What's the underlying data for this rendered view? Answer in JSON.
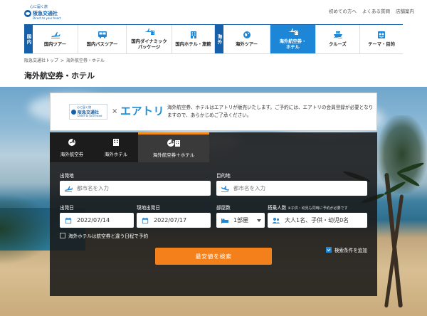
{
  "logo": {
    "tagline": "心に届く旅",
    "name": "阪急交通社",
    "english": "Direct to your heart"
  },
  "utility_links": [
    "初めての方へ",
    "よくある質問",
    "店舗案内"
  ],
  "nav": {
    "domestic_label": "国内",
    "overseas_label": "海外",
    "domestic_items": [
      {
        "label": "国内ツアー",
        "icon": "plane-domestic-icon"
      },
      {
        "label": "国内バスツアー",
        "icon": "bus-icon"
      },
      {
        "label": "国内ダイナミック\nパッケージ",
        "icon": "dynamic-package-icon"
      },
      {
        "label": "国内ホテル・旅館",
        "icon": "hotel-icon"
      }
    ],
    "overseas_items": [
      {
        "label": "海外ツアー",
        "icon": "globe-icon"
      },
      {
        "label": "海外航空券・\nホテル",
        "icon": "plane-hotel-icon",
        "active": true
      },
      {
        "label": "クルーズ",
        "icon": "cruise-icon"
      },
      {
        "label": "テーマ・目的",
        "icon": "theme-icon"
      }
    ]
  },
  "breadcrumb": [
    "阪急交通社トップ",
    "海外航空券・ホテル"
  ],
  "page_title": "海外航空券・ホテル",
  "partner": {
    "logo_tagline": "心に届く旅",
    "logo_name": "阪急交通社",
    "logo_english": "Direct to your heart",
    "times": "×",
    "brand": "エアトリ",
    "text": "海外航空券、ホテルはエアトリが販売いたします。ご予約には、エアトリの会員登録が必要となりますので、あらかじめご了承ください。"
  },
  "tabs": [
    {
      "label": "海外航空券",
      "icon": "plane-globe-icon"
    },
    {
      "label": "海外ホテル",
      "icon": "building-icon"
    },
    {
      "label": "海外航空券＋ホテル",
      "icon": "plane-globe-building-icon",
      "active": true
    }
  ],
  "form": {
    "departure_label": "出発地",
    "departure_placeholder": "都市名を入力",
    "destination_label": "目的地",
    "destination_placeholder": "都市名を入力",
    "depart_date_label": "出発日",
    "depart_date_value": "2022/07/14",
    "local_date_label": "現地出発日",
    "local_date_value": "2022/07/17",
    "rooms_label": "部屋数",
    "rooms_value": "1部屋",
    "passengers_label": "搭乗人数",
    "passengers_note": "※子供・幼児も同時に予約が必要です",
    "passengers_value": "大人1名、子供・幼児0名",
    "different_dates_label": "海外ホテルは航空券と違う日程で予約",
    "search_button": "最安値を検索",
    "add_conditions": "検索条件を追加"
  },
  "colors": {
    "brand_blue": "#1560a8",
    "active_nav": "#1d86d6",
    "search_orange": "#f3801b",
    "airtrip_blue": "#1e8fd6"
  }
}
